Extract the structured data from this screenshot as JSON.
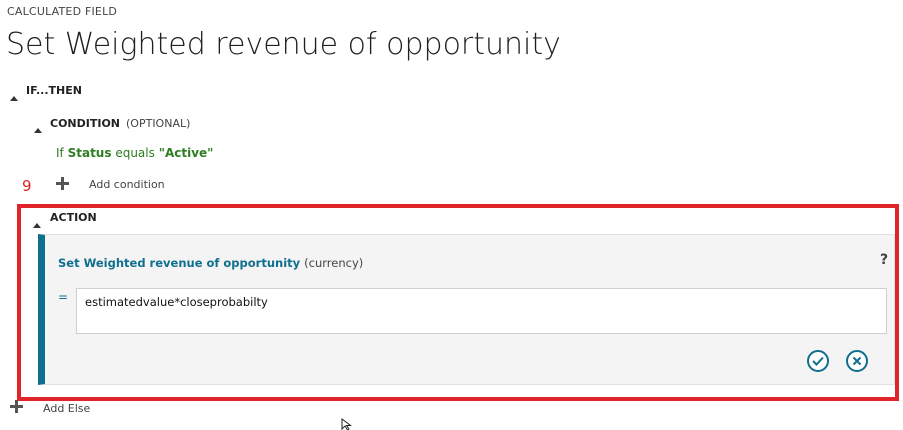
{
  "header": {
    "kind_label": "CALCULATED FIELD",
    "title": "Set Weighted revenue of opportunity"
  },
  "if_then": {
    "label": "IF...THEN"
  },
  "condition": {
    "label": "CONDITION",
    "optional": "(OPTIONAL)",
    "rule": {
      "prefix": "If",
      "field": "Status",
      "operator": "equals",
      "value": "\"Active\""
    },
    "add_label": "Add condition"
  },
  "annotation": {
    "number": "9",
    "color": "#e0242a"
  },
  "action": {
    "label": "ACTION",
    "title": "Set Weighted revenue of opportunity",
    "type": "(currency)",
    "help": "?",
    "equals": "=",
    "expression": "estimatedvalue*closeprobabilty",
    "confirm_icon": "check-circle-icon",
    "cancel_icon": "x-circle-icon"
  },
  "else": {
    "add_label": "Add Else"
  },
  "colors": {
    "accent": "#0f6f8e",
    "condition_text": "#2f7d22",
    "highlight": "#e0242a"
  }
}
